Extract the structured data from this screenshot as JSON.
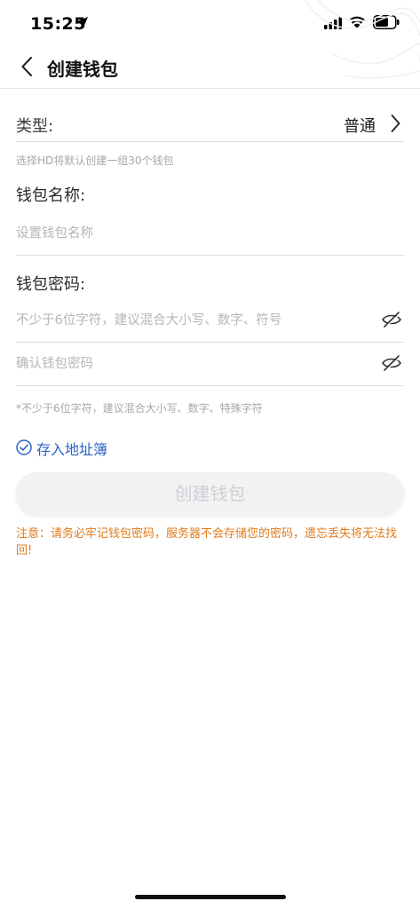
{
  "status_bar": {
    "time": "15:25"
  },
  "nav": {
    "title": "创建钱包"
  },
  "type_row": {
    "label": "类型:",
    "value": "普通"
  },
  "type_hint": "选择HD将默认创建一组30个钱包",
  "wallet_name": {
    "title": "钱包名称:",
    "placeholder": "设置钱包名称"
  },
  "wallet_password": {
    "title": "钱包密码:",
    "password_placeholder": "不少于6位字符，建议混合大小写、数字、符号",
    "confirm_placeholder": "确认钱包密码",
    "hint": "*不少于6位字符，建议混合大小写、数字、特殊字符"
  },
  "address_book": {
    "label": "存入地址簿",
    "checked": true
  },
  "create_button": {
    "label": "创建钱包",
    "enabled": false
  },
  "warning": "注意：请务必牢记钱包密码，服务器不会存储您的密码，遗忘丢失将无法找回!",
  "colors": {
    "accent": "#2a62c8",
    "warning": "#e07a1c",
    "disabled_button": "#f2f2f4"
  }
}
